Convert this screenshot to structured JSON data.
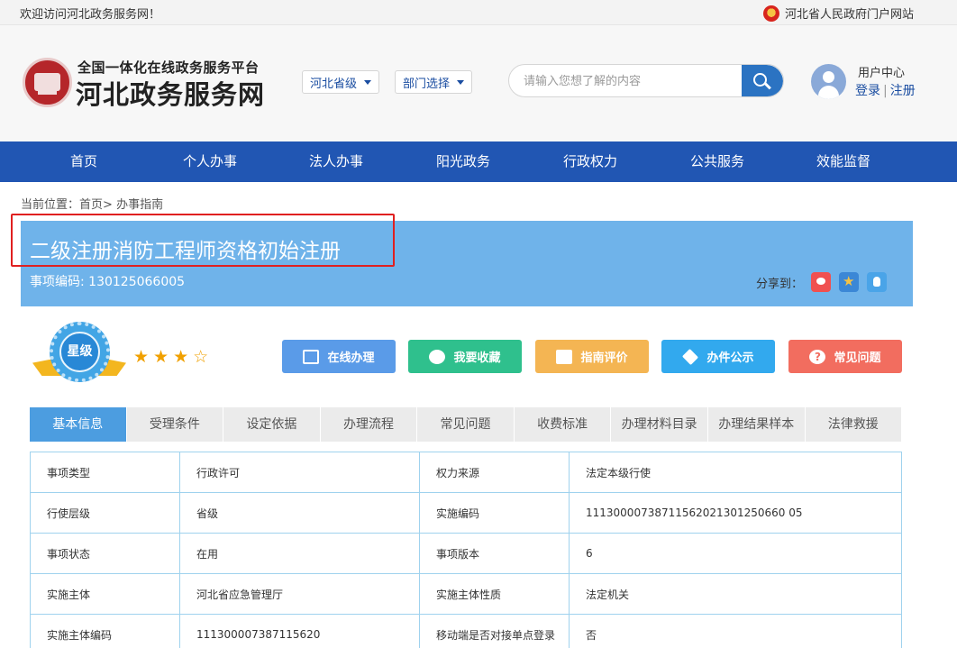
{
  "topbar": {
    "welcome": "欢迎访问河北政务服务网！",
    "portal_link": "河北省人民政府门户网站"
  },
  "logo": {
    "line1": "全国一体化在线政务服务平台",
    "line2": "河北政务服务网"
  },
  "selectors": {
    "region": "河北省级",
    "department": "部门选择"
  },
  "search": {
    "placeholder": "请输入您想了解的内容"
  },
  "user": {
    "center": "用户中心",
    "login": "登录",
    "separator": "|",
    "register": "注册"
  },
  "nav": {
    "items": [
      "首页",
      "个人办事",
      "法人办事",
      "阳光政务",
      "行政权力",
      "公共服务",
      "效能监督"
    ]
  },
  "breadcrumb": {
    "label": "当前位置：",
    "home": "首页>",
    "current": "办事指南"
  },
  "item": {
    "title": "二级注册消防工程师资格初始注册",
    "code_label": "事项编码:",
    "code_value": "130125066005",
    "share_label": "分享到："
  },
  "rating": {
    "badge_text": "星级",
    "stars": 3,
    "max_stars": 4,
    "filled_glyph": "★",
    "empty_glyph": "☆"
  },
  "actions": [
    {
      "label": "在线办理",
      "color": "#5a9be8",
      "icon": "monitor-icon"
    },
    {
      "label": "我要收藏",
      "color": "#2fc08d",
      "icon": "favorite-icon"
    },
    {
      "label": "指南评价",
      "color": "#f4b553",
      "icon": "evaluate-icon"
    },
    {
      "label": "办件公示",
      "color": "#32a9ee",
      "icon": "layers-icon"
    },
    {
      "label": "常见问题",
      "color": "#f26d5f",
      "icon": "question-icon"
    }
  ],
  "tabs": [
    "基本信息",
    "受理条件",
    "设定依据",
    "办理流程",
    "常见问题",
    "收费标准",
    "办理材料目录",
    "办理结果样本",
    "法律救援"
  ],
  "active_tab": 0,
  "info_rows": [
    [
      "事项类型",
      "行政许可",
      "权力来源",
      "法定本级行使"
    ],
    [
      "行使层级",
      "省级",
      "实施编码",
      "11130000738711562021301250660 05"
    ],
    [
      "事项状态",
      "在用",
      "事项版本",
      "6"
    ],
    [
      "实施主体",
      "河北省应急管理厅",
      "实施主体性质",
      "法定机关"
    ],
    [
      "实施主体编码",
      "111300007387115620",
      "移动端是否对接单点登录",
      "否"
    ]
  ],
  "colors": {
    "nav_bg": "#2156b3",
    "item_header_bg": "#6fb3ea",
    "active_tab": "#4c9de0",
    "highlight_outline": "#e02020"
  }
}
